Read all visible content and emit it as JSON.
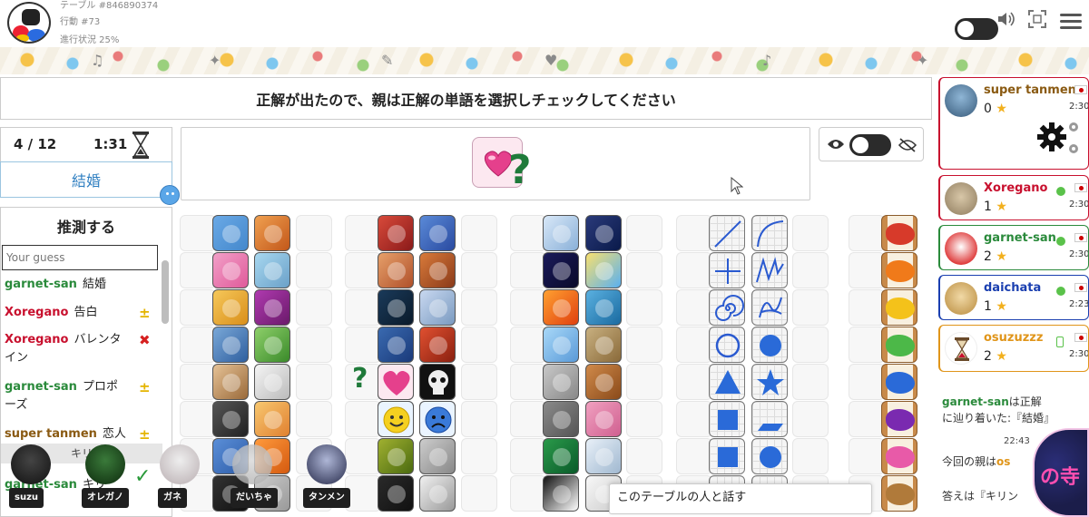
{
  "header": {
    "table_label": "テーブル #846890374",
    "action_label": "行動 #73",
    "progress_label": "進行状況 25%"
  },
  "instruction": "正解が出たので、親は正解の単語を選択しチェックしてください",
  "round": {
    "count": "4 / 12",
    "timer": "1:31",
    "word": "結婚"
  },
  "guess": {
    "title": "推測する",
    "placeholder": "Your guess",
    "entries": [
      {
        "who": "garnet-san",
        "text": "結婚",
        "color": "#2a8a3b",
        "mark": ""
      },
      {
        "who": "Xoregano",
        "text": "告白",
        "color": "#c8102e",
        "mark": "±"
      },
      {
        "who": "Xoregano",
        "text": "バレンタ",
        "text2": "イン",
        "color": "#c8102e",
        "mark": "✖"
      },
      {
        "who": "garnet-san",
        "text": "プロポ",
        "text2": "ーズ",
        "color": "#2a8a3b",
        "mark": "±"
      },
      {
        "who": "super tanmen",
        "text": "恋人",
        "color": "#8a5a12",
        "mark": "±"
      }
    ],
    "divider": "キリ",
    "last_who": "garnet-san",
    "last_text": "キリ"
  },
  "players": [
    {
      "name": "super tanmen",
      "score": "0",
      "time": "2:30",
      "name_color": "#8a5a12",
      "border": "#c8102e"
    },
    {
      "name": "Xoregano",
      "score": "1",
      "time": "2:30",
      "name_color": "#c8102e",
      "border": "#c8102e"
    },
    {
      "name": "garnet-san",
      "score": "2",
      "time": "2:30",
      "name_color": "#2a8a3b",
      "border": "#2a8a3b"
    },
    {
      "name": "daichata",
      "score": "1",
      "time": "2:23",
      "name_color": "#1a3fb0",
      "border": "#1a3fb0"
    },
    {
      "name": "osuzuzzz",
      "score": "2",
      "time": "2:30",
      "name_color": "#e0951a",
      "border": "#e0951a"
    }
  ],
  "chat": {
    "msg1_who": "garnet-san",
    "msg1_text": "は正解に辿り着いた:『結婚』",
    "time": "22:43",
    "msg2_text": "今回の親は",
    "msg2_who": "os",
    "msg3_text": "答えは『キリン"
  },
  "cams": [
    {
      "label": "suzu"
    },
    {
      "label": "オレガノ"
    },
    {
      "label": "ガネ"
    },
    {
      "label": "だいちゃ"
    },
    {
      "label": "タンメン"
    }
  ],
  "talk_popup": "このテーブルの人と話す",
  "overlay_text": "の寺"
}
